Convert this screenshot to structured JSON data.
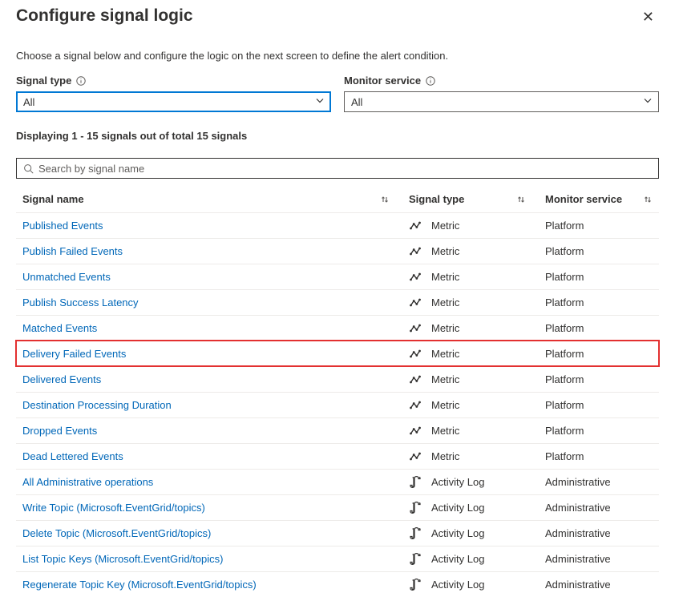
{
  "header": {
    "title": "Configure signal logic",
    "close_aria": "Close"
  },
  "description": "Choose a signal below and configure the logic on the next screen to define the alert condition.",
  "filters": {
    "signal_type": {
      "label": "Signal type",
      "value": "All"
    },
    "monitor_service": {
      "label": "Monitor service",
      "value": "All"
    }
  },
  "count_line": "Displaying 1 - 15 signals out of total 15 signals",
  "search": {
    "placeholder": "Search by signal name",
    "value": ""
  },
  "columns": {
    "name": "Signal name",
    "type": "Signal type",
    "service": "Monitor service"
  },
  "signals": [
    {
      "name": "Published Events",
      "type": "Metric",
      "service": "Platform",
      "highlight": false
    },
    {
      "name": "Publish Failed Events",
      "type": "Metric",
      "service": "Platform",
      "highlight": false
    },
    {
      "name": "Unmatched Events",
      "type": "Metric",
      "service": "Platform",
      "highlight": false
    },
    {
      "name": "Publish Success Latency",
      "type": "Metric",
      "service": "Platform",
      "highlight": false
    },
    {
      "name": "Matched Events",
      "type": "Metric",
      "service": "Platform",
      "highlight": false
    },
    {
      "name": "Delivery Failed Events",
      "type": "Metric",
      "service": "Platform",
      "highlight": true
    },
    {
      "name": "Delivered Events",
      "type": "Metric",
      "service": "Platform",
      "highlight": false
    },
    {
      "name": "Destination Processing Duration",
      "type": "Metric",
      "service": "Platform",
      "highlight": false
    },
    {
      "name": "Dropped Events",
      "type": "Metric",
      "service": "Platform",
      "highlight": false
    },
    {
      "name": "Dead Lettered Events",
      "type": "Metric",
      "service": "Platform",
      "highlight": false
    },
    {
      "name": "All Administrative operations",
      "type": "Activity Log",
      "service": "Administrative",
      "highlight": false
    },
    {
      "name": "Write Topic (Microsoft.EventGrid/topics)",
      "type": "Activity Log",
      "service": "Administrative",
      "highlight": false
    },
    {
      "name": "Delete Topic (Microsoft.EventGrid/topics)",
      "type": "Activity Log",
      "service": "Administrative",
      "highlight": false
    },
    {
      "name": "List Topic Keys (Microsoft.EventGrid/topics)",
      "type": "Activity Log",
      "service": "Administrative",
      "highlight": false
    },
    {
      "name": "Regenerate Topic Key (Microsoft.EventGrid/topics)",
      "type": "Activity Log",
      "service": "Administrative",
      "highlight": false
    }
  ]
}
